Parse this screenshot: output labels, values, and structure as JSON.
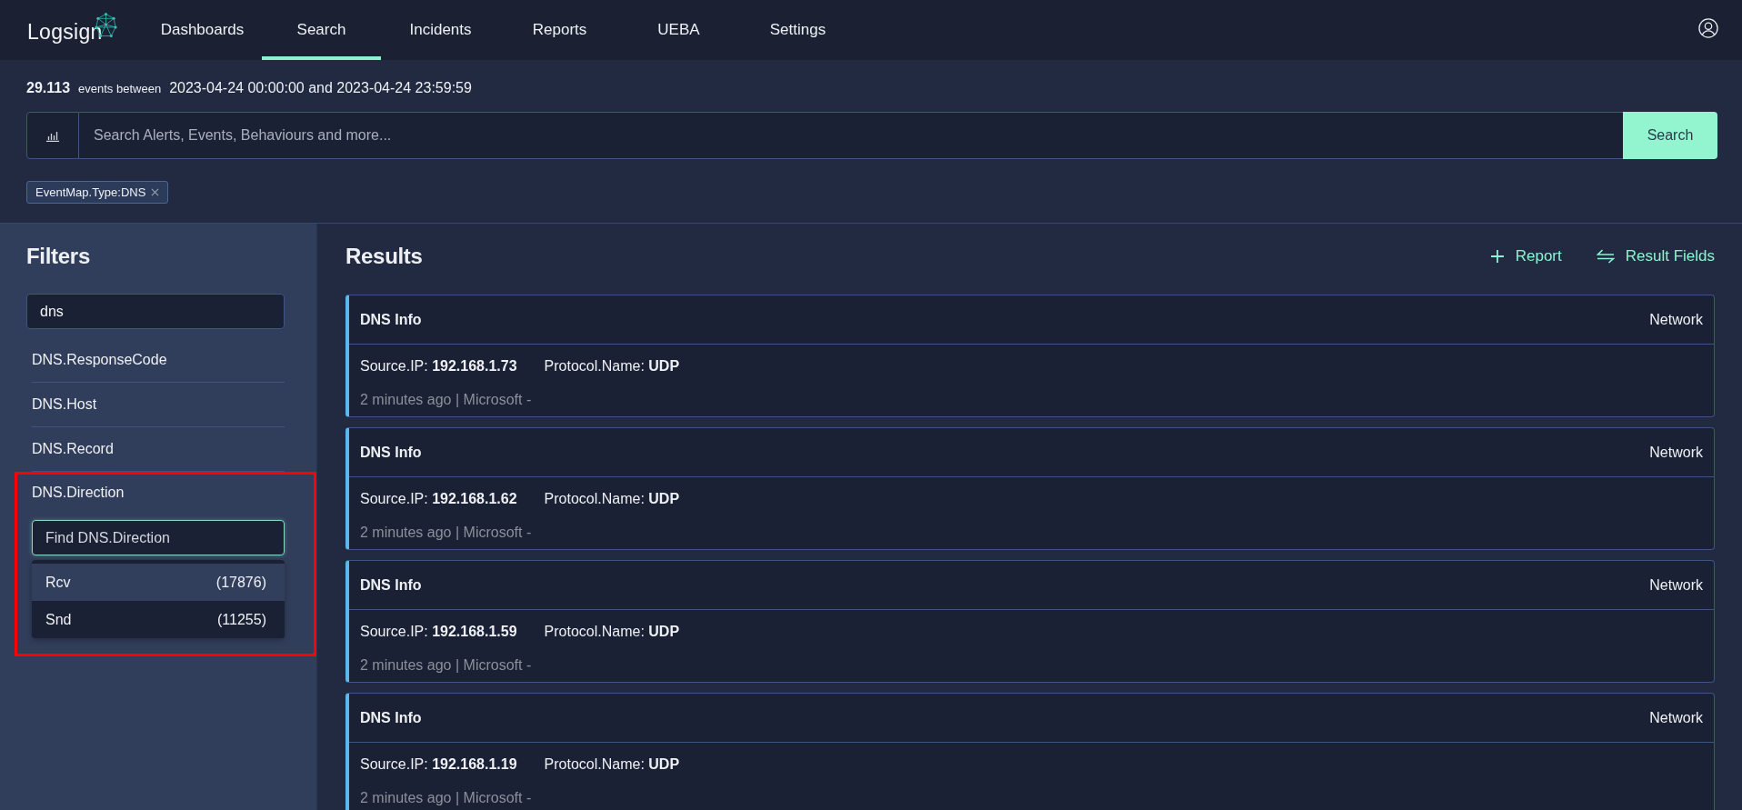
{
  "nav": {
    "logo": "Logsign",
    "items": [
      {
        "label": "Dashboards",
        "selected": false
      },
      {
        "label": "Search",
        "selected": true
      },
      {
        "label": "Incidents",
        "selected": false
      },
      {
        "label": "Reports",
        "selected": false
      },
      {
        "label": "UEBA",
        "selected": false
      },
      {
        "label": "Settings",
        "selected": false
      }
    ]
  },
  "summary": {
    "count": "29.113",
    "label": "events between",
    "range": "2023-04-24 00:00:00 and 2023-04-24 23:59:59"
  },
  "search": {
    "placeholder": "Search Alerts, Events, Behaviours and more...",
    "button": "Search"
  },
  "active_filters": [
    {
      "label": "EventMap.Type:DNS"
    }
  ],
  "filters": {
    "title": "Filters",
    "search_value": "dns",
    "items": [
      {
        "label": "DNS.ResponseCode",
        "expanded": false
      },
      {
        "label": "DNS.Host",
        "expanded": false
      },
      {
        "label": "DNS.Record",
        "expanded": false
      },
      {
        "label": "DNS.Direction",
        "expanded": true,
        "highlighted": true,
        "find_placeholder": "Find DNS.Direction",
        "values": [
          {
            "label": "Rcv",
            "count": "(17876)",
            "selected": true
          },
          {
            "label": "Snd",
            "count": "(11255)",
            "selected": false
          }
        ]
      }
    ]
  },
  "results": {
    "title": "Results",
    "actions": [
      {
        "kind": "add",
        "label": "Report"
      },
      {
        "kind": "swap",
        "label": "Result Fields"
      }
    ],
    "cards": [
      {
        "title": "DNS Info",
        "category": "Network",
        "fields": [
          "Source.IP: **192.168.1.73**",
          "Protocol.Name: **UDP**"
        ],
        "meta": "2 minutes ago | Microsoft -"
      },
      {
        "title": "DNS Info",
        "category": "Network",
        "fields": [
          "Source.IP: **192.168.1.62**",
          "Protocol.Name: **UDP**"
        ],
        "meta": "2 minutes ago | Microsoft -"
      },
      {
        "title": "DNS Info",
        "category": "Network",
        "fields": [
          "Source.IP: **192.168.1.59**",
          "Protocol.Name: **UDP**"
        ],
        "meta": "2 minutes ago | Microsoft -"
      },
      {
        "title": "DNS Info",
        "category": "Network",
        "fields": [
          "Source.IP: **192.168.1.19**",
          "Protocol.Name: **UDP**"
        ],
        "meta": "2 minutes ago | Microsoft -"
      }
    ]
  }
}
